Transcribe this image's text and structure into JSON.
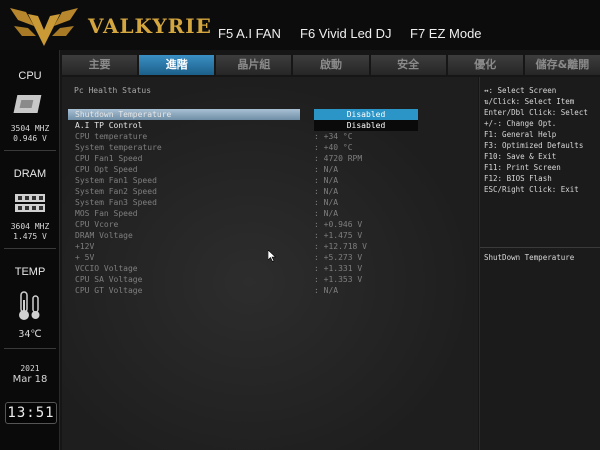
{
  "header": {
    "brand": "VALKYRIE",
    "functions": [
      "F5 A.I FAN",
      "F6 Vivid Led DJ",
      "F7 EZ Mode"
    ],
    "colors": {
      "brand_gold": "#d4a640",
      "tab_active": "#2c95c8"
    }
  },
  "sidebar": {
    "cpu": {
      "label": "CPU",
      "freq": "3504 MHZ",
      "volt": "0.946 V",
      "icon": "cpu-chip-icon"
    },
    "dram": {
      "label": "DRAM",
      "freq": "3604 MHZ",
      "volt": "1.475 V",
      "icon": "memory-module-icon"
    },
    "temp": {
      "label": "TEMP",
      "value": "34℃",
      "icon": "thermometer-icon"
    },
    "date": {
      "year": "2021",
      "month_day": "Mar 18"
    },
    "clock": "13:51"
  },
  "tabs": [
    {
      "label": "主要",
      "active": false
    },
    {
      "label": "進階",
      "active": true
    },
    {
      "label": "晶片組",
      "active": false
    },
    {
      "label": "啟動",
      "active": false
    },
    {
      "label": "安全",
      "active": false
    },
    {
      "label": "優化",
      "active": false
    },
    {
      "label": "儲存&離開",
      "active": false
    }
  ],
  "main": {
    "section_title": "Pc Health Status",
    "rows": [
      {
        "label": "Shutdown Temperature",
        "value": "Disabled",
        "selected": true,
        "option": "active"
      },
      {
        "label": "A.I TP Control",
        "value": "Disabled",
        "option": "normal"
      },
      {
        "label": "CPU temperature",
        "value": ": +34  °C"
      },
      {
        "label": "System temperature",
        "value": ": +40  °C"
      },
      {
        "label": "CPU Fan1 Speed",
        "value": ": 4720 RPM"
      },
      {
        "label": "CPU Opt Speed",
        "value": ": N/A"
      },
      {
        "label": "System Fan1 Speed",
        "value": ": N/A"
      },
      {
        "label": "System Fan2 Speed",
        "value": ": N/A"
      },
      {
        "label": "System Fan3 Speed",
        "value": ": N/A"
      },
      {
        "label": "MOS Fan Speed",
        "value": ": N/A"
      },
      {
        "label": "CPU Vcore",
        "value": ": +0.946 V"
      },
      {
        "label": "DRAM Voltage",
        "value": ": +1.475 V"
      },
      {
        "label": "+12V",
        "value": ": +12.718 V"
      },
      {
        "label": "+ 5V",
        "value": ": +5.273 V"
      },
      {
        "label": "VCCIO Voltage",
        "value": ": +1.331 V"
      },
      {
        "label": "CPU SA Voltage",
        "value": ": +1.353 V"
      },
      {
        "label": "CPU GT Voltage",
        "value": ": N/A"
      }
    ]
  },
  "help": {
    "keys": [
      "↔: Select Screen",
      "⇅/Click: Select Item",
      "Enter/Dbl Click: Select",
      "+/-: Change Opt.",
      "F1: General Help",
      "F3: Optimized Defaults",
      "F10: Save & Exit",
      "F11: Print Screen",
      "F12: BIOS Flash",
      "ESC/Right Click: Exit"
    ],
    "description": "ShutDown Temperature"
  }
}
